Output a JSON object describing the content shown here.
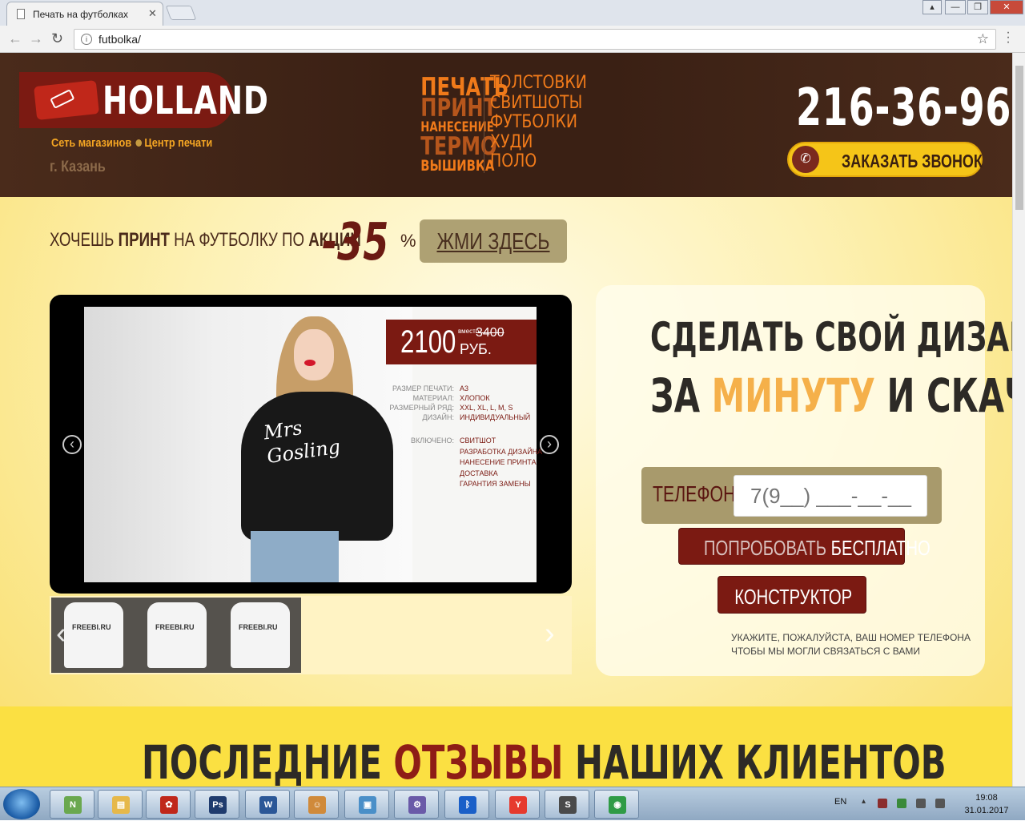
{
  "browser": {
    "tab_title": "Печать на футболках",
    "tab_close": "✕",
    "url": "futbolka/",
    "window_controls": [
      "▴",
      "—",
      "❐",
      "✕"
    ]
  },
  "header": {
    "logo_text": "HOLLAND",
    "logo_sub_left": "Сеть магазинов",
    "logo_sub_right": "Центр печати",
    "city": "г. Казань",
    "services_left": [
      {
        "text": "ПЕЧАТЬ",
        "color": "#f07a1a"
      },
      {
        "text": "ПРИНТ",
        "color": "#b6561c"
      },
      {
        "text": "НАНЕСЕНИЕ",
        "color": "#f07a1a"
      },
      {
        "text": "ТЕРМО",
        "color": "#b6561c"
      },
      {
        "text": "ВЫШИВКА",
        "color": "#f07a1a"
      }
    ],
    "services_right": [
      "ТОЛСТОВКИ",
      "СВИТШОТЫ",
      "ФУТБОЛКИ",
      "ХУДИ",
      "ПОЛО"
    ],
    "phone": "216-36-96",
    "call_button": "ЗАКАЗАТЬ ЗВОНОК"
  },
  "promo": {
    "text_a": "ХОЧЕШЬ ",
    "text_b": "ПРИНТ",
    "text_c": " НА ФУТБОЛКУ ПО ",
    "text_d": "АКЦИИ",
    "discount": "-35",
    "percent": "%",
    "button": "ЖМИ ЗДЕСЬ"
  },
  "slide": {
    "price": "2100",
    "instead_label": "вместо",
    "old_price": "3400",
    "currency": "РУБ.",
    "shirt_text_1": "Mrs",
    "shirt_text_2": "Gosling",
    "specs": [
      {
        "key": "РАЗМЕР ПЕЧАТИ:",
        "value": "А3"
      },
      {
        "key": "МАТЕРИАЛ:",
        "value": "ХЛОПОК"
      },
      {
        "key": "РАЗМЕРНЫЙ РЯД:",
        "value": "XXL, XL, L, M, S"
      },
      {
        "key": "ДИЗАЙН:",
        "value": "ИНДИВИДУАЛЬНЫЙ"
      }
    ],
    "included_label": "ВКЛЮЧЕНО:",
    "included": [
      "СВИТШОТ",
      "РАЗРАБОТКА ДИЗАЙНА",
      "НАНЕСЕНИЕ ПРИНТА",
      "ДОСТАВКА",
      "ГАРАНТИЯ ЗАМЕНЫ"
    ],
    "prev": "‹",
    "next": "›"
  },
  "thumbs": {
    "label": "FREEBI.RU",
    "prev": "‹",
    "next": "›"
  },
  "form": {
    "title_line1": "СДЕЛАТЬ СВОЙ ДИЗАЙН",
    "title_line2_a": "ЗА ",
    "title_line2_hl": "МИНУТУ",
    "title_line2_b": " И СКАЧАЙ",
    "phone_label": "ТЕЛЕФОН:",
    "phone_placeholder": "7(9__) ___-__-__",
    "try_button_a": "ПОПРОБОВАТЬ ",
    "try_button_b": "БЕСПЛАТНО",
    "constructor_button": "КОНСТРУКТОР",
    "note_line1": "УКАЖИТЕ, ПОЖАЛУЙСТА, ВАШ НОМЕР ТЕЛЕФОНА",
    "note_line2": "ЧТОБЫ МЫ МОГЛИ СВЯЗАТЬСЯ С ВАМИ"
  },
  "reviews": {
    "title_a": "ПОСЛЕДНИЕ ",
    "title_hl": "ОТЗЫВЫ",
    "title_b": " НАШИХ КЛИЕНТОВ"
  },
  "taskbar": {
    "apps": [
      {
        "name": "notepad-plus-app",
        "glyph": "N",
        "color": "#6aa84f"
      },
      {
        "name": "file-explorer-app",
        "glyph": "▤",
        "color": "#e6b84a"
      },
      {
        "name": "filezilla-app",
        "glyph": "✿",
        "color": "#c0271a"
      },
      {
        "name": "photoshop-app",
        "glyph": "Ps",
        "color": "#1f3b6e"
      },
      {
        "name": "word-app",
        "glyph": "W",
        "color": "#2b5797"
      },
      {
        "name": "contacts-app",
        "glyph": "☺",
        "color": "#d08a3a"
      },
      {
        "name": "photo-viewer-app",
        "glyph": "▣",
        "color": "#4a8fc8"
      },
      {
        "name": "network-app",
        "glyph": "⚙",
        "color": "#6a5aa8"
      },
      {
        "name": "bluetooth-app",
        "glyph": "ᛒ",
        "color": "#1a5fc8"
      },
      {
        "name": "yandex-browser-app",
        "glyph": "Y",
        "color": "#e63a2e"
      },
      {
        "name": "sublime-text-app",
        "glyph": "S",
        "color": "#4a4a4a"
      },
      {
        "name": "chrome-app",
        "glyph": "◉",
        "color": "#2f9b46"
      }
    ],
    "lang": "EN",
    "time": "19:08",
    "date": "31.01.2017"
  }
}
